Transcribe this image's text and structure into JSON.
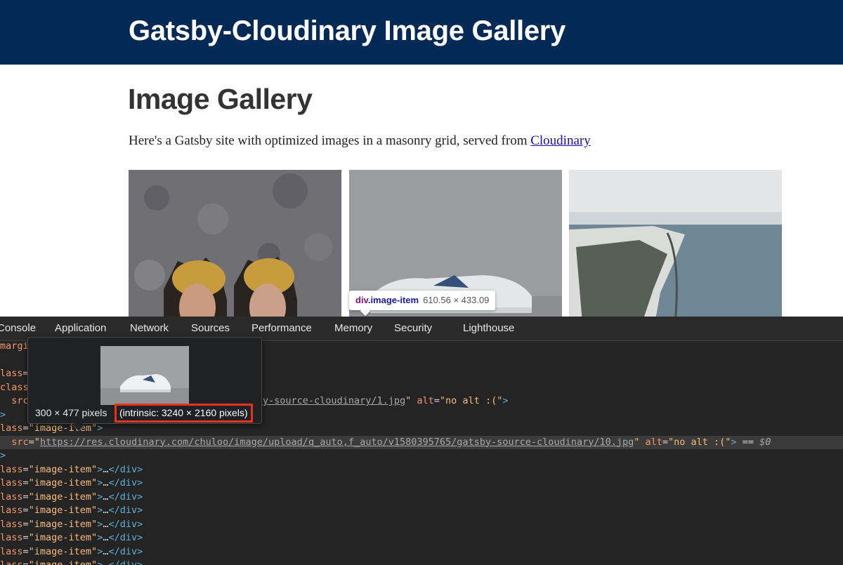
{
  "header": {
    "title": "Gatsby-Cloudinary Image Gallery"
  },
  "main": {
    "heading": "Image Gallery",
    "intro_text": "Here's a Gatsby site with optimized images in a masonry grid, served from ",
    "intro_link": "Cloudinary",
    "images": [
      "bride-portrait-photo",
      "sneaker-photo",
      "coastal-town-aerial-photo"
    ]
  },
  "inspect_tooltip": {
    "tag": "div",
    "class": ".image-item",
    "dimensions": "610.56 × 433.09"
  },
  "devtools": {
    "tabs": [
      "Console",
      "Application",
      "Network",
      "Sources",
      "Performance",
      "Memory",
      "Security",
      "Lighthouse"
    ],
    "lines": [
      {
        "parts": [
          [
            "c-attr",
            "margi"
          ]
        ]
      },
      {
        "parts": []
      },
      {
        "parts": [
          [
            "c-attr",
            "lass"
          ],
          [
            "c-text",
            "="
          ],
          [
            "c-val",
            "\""
          ]
        ]
      },
      {
        "parts": [
          [
            "c-attr",
            "class"
          ],
          [
            "c-text",
            "="
          ]
        ]
      },
      {
        "parts": [
          [
            "c-text",
            "  "
          ],
          [
            "c-attr",
            "src"
          ],
          [
            "c-text",
            "="
          ],
          [
            "c-link",
            "e/upload/q_auto,f_auto/v1580395764/gatsby-source-cloudinary/1.jpg"
          ],
          [
            "c-val",
            "\""
          ],
          [
            "c-text",
            " "
          ],
          [
            "c-attr",
            "alt"
          ],
          [
            "c-text",
            "="
          ],
          [
            "c-val",
            "\"no alt :(\""
          ],
          [
            "c-tag",
            ">"
          ]
        ]
      },
      {
        "parts": [
          [
            "c-tag",
            ">"
          ]
        ]
      },
      {
        "parts": [
          [
            "c-attr",
            "lass"
          ],
          [
            "c-text",
            "="
          ],
          [
            "c-val",
            "\"image-item\""
          ],
          [
            "c-tag",
            ">"
          ]
        ]
      },
      {
        "parts": [
          [
            "c-text",
            "  "
          ],
          [
            "c-attr",
            "src"
          ],
          [
            "c-text",
            "="
          ],
          [
            "c-val",
            "\""
          ],
          [
            "c-link",
            "https://res.cloudinary.com/chuloo/image/upload/q_auto,f_auto/v1580395765/gatsby-source-cloudinary/10.jpg"
          ],
          [
            "c-val",
            "\""
          ],
          [
            "c-text",
            " "
          ],
          [
            "c-attr",
            "alt"
          ],
          [
            "c-text",
            "="
          ],
          [
            "c-val",
            "\"no alt :(\""
          ],
          [
            "c-tag",
            ">"
          ],
          [
            "c-text",
            " == "
          ],
          [
            "c-ref",
            "$0"
          ]
        ]
      },
      {
        "parts": [
          [
            "c-tag",
            ">"
          ]
        ]
      },
      {
        "parts": [
          [
            "c-attr",
            "lass"
          ],
          [
            "c-text",
            "="
          ],
          [
            "c-val",
            "\"image-item\""
          ],
          [
            "c-tag",
            ">"
          ],
          [
            "c-text",
            "…"
          ],
          [
            "c-tag",
            "</div>"
          ]
        ]
      },
      {
        "parts": [
          [
            "c-attr",
            "lass"
          ],
          [
            "c-text",
            "="
          ],
          [
            "c-val",
            "\"image-item\""
          ],
          [
            "c-tag",
            ">"
          ],
          [
            "c-text",
            "…"
          ],
          [
            "c-tag",
            "</div>"
          ]
        ]
      },
      {
        "parts": [
          [
            "c-attr",
            "lass"
          ],
          [
            "c-text",
            "="
          ],
          [
            "c-val",
            "\"image-item\""
          ],
          [
            "c-tag",
            ">"
          ],
          [
            "c-text",
            "…"
          ],
          [
            "c-tag",
            "</div>"
          ]
        ]
      },
      {
        "parts": [
          [
            "c-attr",
            "lass"
          ],
          [
            "c-text",
            "="
          ],
          [
            "c-val",
            "\"image-item\""
          ],
          [
            "c-tag",
            ">"
          ],
          [
            "c-text",
            "…"
          ],
          [
            "c-tag",
            "</div>"
          ]
        ]
      },
      {
        "parts": [
          [
            "c-attr",
            "lass"
          ],
          [
            "c-text",
            "="
          ],
          [
            "c-val",
            "\"image-item\""
          ],
          [
            "c-tag",
            ">"
          ],
          [
            "c-text",
            "…"
          ],
          [
            "c-tag",
            "</div>"
          ]
        ]
      },
      {
        "parts": [
          [
            "c-attr",
            "lass"
          ],
          [
            "c-text",
            "="
          ],
          [
            "c-val",
            "\"image-item\""
          ],
          [
            "c-tag",
            ">"
          ],
          [
            "c-text",
            "…"
          ],
          [
            "c-tag",
            "</div>"
          ]
        ]
      },
      {
        "parts": [
          [
            "c-attr",
            "lass"
          ],
          [
            "c-text",
            "="
          ],
          [
            "c-val",
            "\"image-item\""
          ],
          [
            "c-tag",
            ">"
          ],
          [
            "c-text",
            "…"
          ],
          [
            "c-tag",
            "</div>"
          ]
        ]
      },
      {
        "parts": [
          [
            "c-attr",
            "lass"
          ],
          [
            "c-text",
            "="
          ],
          [
            "c-val",
            "\"image-item\""
          ],
          [
            "c-tag",
            ">"
          ],
          [
            "c-text",
            "…"
          ],
          [
            "c-tag",
            "</div>"
          ]
        ]
      }
    ],
    "selected_line": 7,
    "preview": {
      "rendered_size": "300 × 477 pixels",
      "intrinsic_size": "(intrinsic: 3240 × 2160 pixels)"
    }
  },
  "colors": {
    "header_bg": "#032a56",
    "highlight": "#e0341b",
    "devtools_bg": "#242424"
  }
}
